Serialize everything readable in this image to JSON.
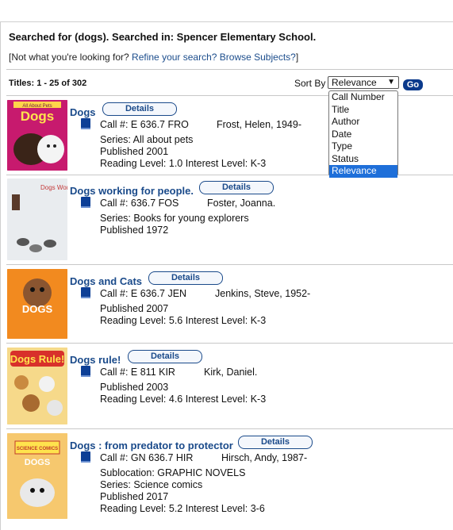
{
  "search": {
    "heading": "Searched for (dogs). Searched in: Spencer Elementary School.",
    "not_looking_prefix": "[Not what you're looking for? ",
    "refine_link": "Refine your search?",
    "browse_link": "Browse Subjects?",
    "not_looking_suffix": "]"
  },
  "results": {
    "count_label": "Titles: 1 - 25 of 302",
    "sort_label": "Sort By",
    "sort_selected": "Relevance",
    "sort_options": [
      "Call Number",
      "Title",
      "Author",
      "Date",
      "Type",
      "Status",
      "Relevance"
    ],
    "go_label": "Go",
    "details_label": "Details"
  },
  "records": [
    {
      "title": "Dogs",
      "call": "Call #: E 636.7 FRO",
      "author": "Frost, Helen, 1949-",
      "lines": [
        "Series: All about pets",
        "Published 2001",
        "Reading Level: 1.0  Interest Level: K-3"
      ],
      "cover_text": "All About Pets",
      "cover_title": "Dogs"
    },
    {
      "title": "Dogs working for people.",
      "call": "Call #: 636.7 FOS",
      "author": "Foster, Joanna.",
      "lines": [
        "Series: Books for young explorers",
        "Published 1972"
      ],
      "cover_text": "Dogs Working for People"
    },
    {
      "title": "Dogs and Cats",
      "call": "Call #: E 636.7 JEN",
      "author": "Jenkins, Steve, 1952-",
      "lines": [
        "Published 2007",
        "Reading Level: 5.6  Interest Level: K-3"
      ],
      "cover_text": "DOGS"
    },
    {
      "title": "Dogs rule!",
      "call": "Call #: E 811 KIR",
      "author": "Kirk, Daniel.",
      "lines": [
        "Published 2003",
        "Reading Level: 4.6  Interest Level: K-3"
      ],
      "cover_text": "Dogs Rule!"
    },
    {
      "title": "Dogs : from predator to protector",
      "call": "Call #: GN 636.7 HIR",
      "author": "Hirsch, Andy, 1987-",
      "lines": [
        "Sublocation: GRAPHIC NOVELS",
        "Series: Science comics",
        "Published 2017",
        "Reading Level: 5.2  Interest Level: 3-6"
      ],
      "cover_text": "SCIENCE COMICS",
      "cover_title": "DOGS"
    }
  ]
}
